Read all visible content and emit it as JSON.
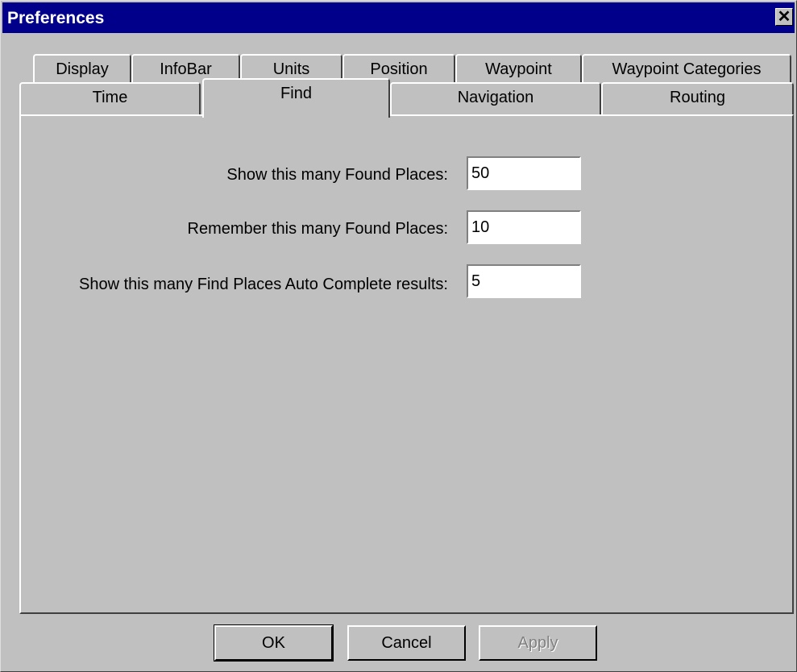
{
  "window": {
    "title": "Preferences",
    "close_glyph": "✕"
  },
  "tabs": {
    "row1": [
      {
        "label": "Display"
      },
      {
        "label": "InfoBar"
      },
      {
        "label": "Units"
      },
      {
        "label": "Position"
      },
      {
        "label": "Waypoint"
      },
      {
        "label": "Waypoint Categories"
      }
    ],
    "row2": [
      {
        "label": "Time"
      },
      {
        "label": "Find"
      },
      {
        "label": "Navigation"
      },
      {
        "label": "Routing"
      }
    ],
    "selected": "Find"
  },
  "find": {
    "show_found_label": "Show this many Found Places:",
    "show_found_value": "50",
    "remember_found_label": "Remember this many Found Places:",
    "remember_found_value": "10",
    "autocomplete_label": "Show this many Find Places Auto Complete results:",
    "autocomplete_value": "5"
  },
  "buttons": {
    "ok": "OK",
    "cancel": "Cancel",
    "apply": "Apply"
  },
  "colors": {
    "titlebar": "#00008b",
    "face": "#c0c0c0"
  },
  "icons": {
    "close": "close-icon"
  }
}
